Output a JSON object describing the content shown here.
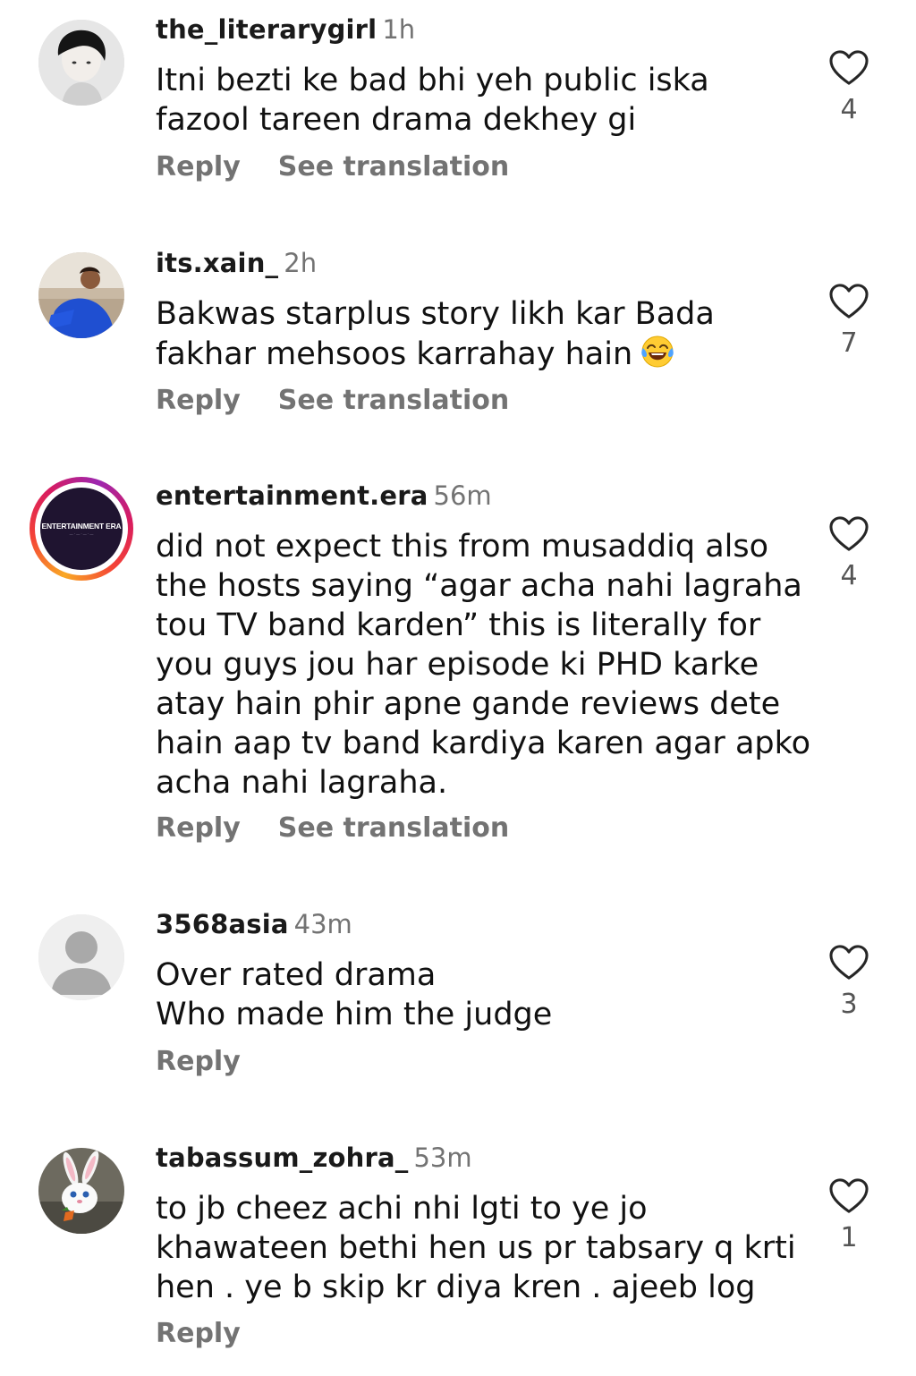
{
  "comments": [
    {
      "username": "the_literarygirl",
      "time": "1h",
      "lines": [
        "Itni bezti ke bad bhi yeh public iska",
        "fazool tareen drama dekhey gi"
      ],
      "reply": "Reply",
      "translation": "See translation",
      "likes": "4",
      "avatar_icon": "profile-photo-icon"
    },
    {
      "username": "its.xain_",
      "time": "2h",
      "lines": [
        "Bakwas starplus story likh kar Bada",
        "fakhar mehsoos karrahay hain"
      ],
      "emoji": "face-with-tears-of-joy-icon",
      "reply": "Reply",
      "translation": "See translation",
      "likes": "7",
      "avatar_icon": "profile-photo-icon"
    },
    {
      "username": "entertainment.era",
      "time": "56m",
      "lines": [
        "did not expect this from musaddiq also",
        "the hosts saying “agar acha nahi lagraha",
        "tou TV band karden” this is literally for",
        "you guys jou har episode ki PHD karke",
        "atay hain phir apne gande reviews dete",
        "hain aap tv band kardiya karen agar apko",
        "acha nahi lagraha."
      ],
      "reply": "Reply",
      "translation": "See translation",
      "likes": "4",
      "avatar_logo_text": "ENTERTAINMENT ERA",
      "avatar_icon": "story-ring-avatar-icon"
    },
    {
      "username": "3568asia",
      "time": "43m",
      "lines": [
        "Over rated drama",
        "Who made him the judge"
      ],
      "reply": "Reply",
      "likes": "3",
      "avatar_icon": "default-user-icon"
    },
    {
      "username": "tabassum_zohra_",
      "time": "53m",
      "lines": [
        "to jb cheez achi nhi lgti to ye jo",
        "khawateen bethi hen us pr tabsary q krti",
        "hen . ye b skip kr diya kren . ajeeb log"
      ],
      "reply": "Reply",
      "likes": "1",
      "avatar_icon": "bunny-avatar-icon"
    }
  ],
  "colors": {
    "username": "#1a1a1a",
    "secondary_text": "#737373",
    "body_text": "#111111",
    "heart_outline": "#262626"
  },
  "icons": {
    "like": "heart-outline-icon"
  }
}
